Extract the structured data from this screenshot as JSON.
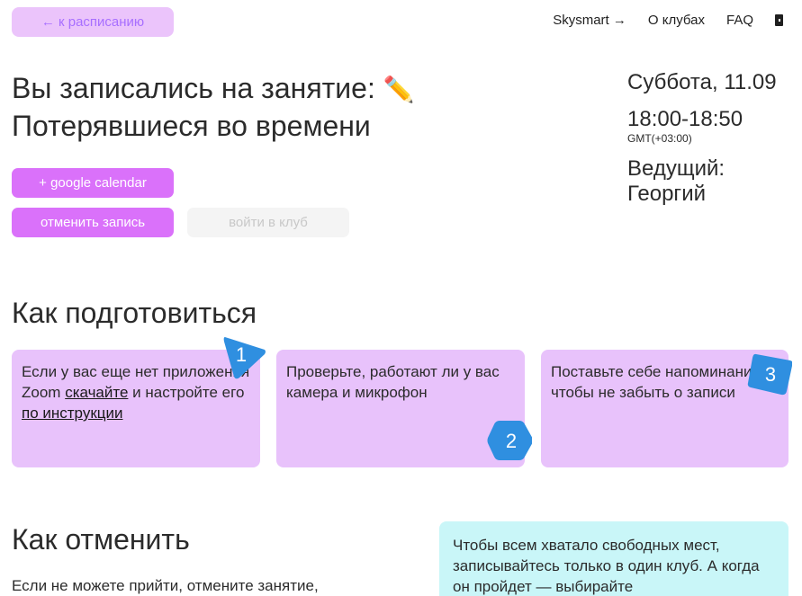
{
  "header": {
    "back_label": "← к расписанию",
    "nav": [
      {
        "label": "Skysmart →"
      },
      {
        "label": "О клубах"
      },
      {
        "label": "FAQ"
      }
    ]
  },
  "lesson": {
    "title_line1": "Вы записались на занятие:",
    "title_icon": "✏️",
    "title_line2": "Потерявшиеся во времени",
    "gcal_label": "+ google calendar",
    "cancel_label": "отменить запись",
    "join_label": "войти в клуб"
  },
  "details": {
    "date": "Суббота, 11.09",
    "time": "18:00-18:50",
    "timezone": "GMT(+03:00)",
    "host": "Ведущий: Георгий"
  },
  "prepare": {
    "heading": "Как подготовиться",
    "cards": [
      {
        "number": "1",
        "text_before": "Если у вас еще нет приложения Zoom ",
        "link1": "скачайте",
        "text_middle": " и настройте его ",
        "link2": "по инструкции"
      },
      {
        "number": "2",
        "text": "Проверьте, работают ли у вас камера и микрофон"
      },
      {
        "number": "3",
        "text": "Поставьте себе напоминание, чтобы не забыть о записи"
      }
    ]
  },
  "cancel_section": {
    "heading": "Как отменить",
    "text": "Если не можете прийти, отмените занятие,",
    "info": "Чтобы всем хватало свободных мест, записывайтесь только в один клуб. А когда он пройдет — выбирайте"
  },
  "colors": {
    "accent": "#da71fa",
    "back_bg": "#ebc4fb",
    "card_bg": "#e8c2fb",
    "badge": "#2f8fe0",
    "info_bg": "#c9f6f8"
  }
}
